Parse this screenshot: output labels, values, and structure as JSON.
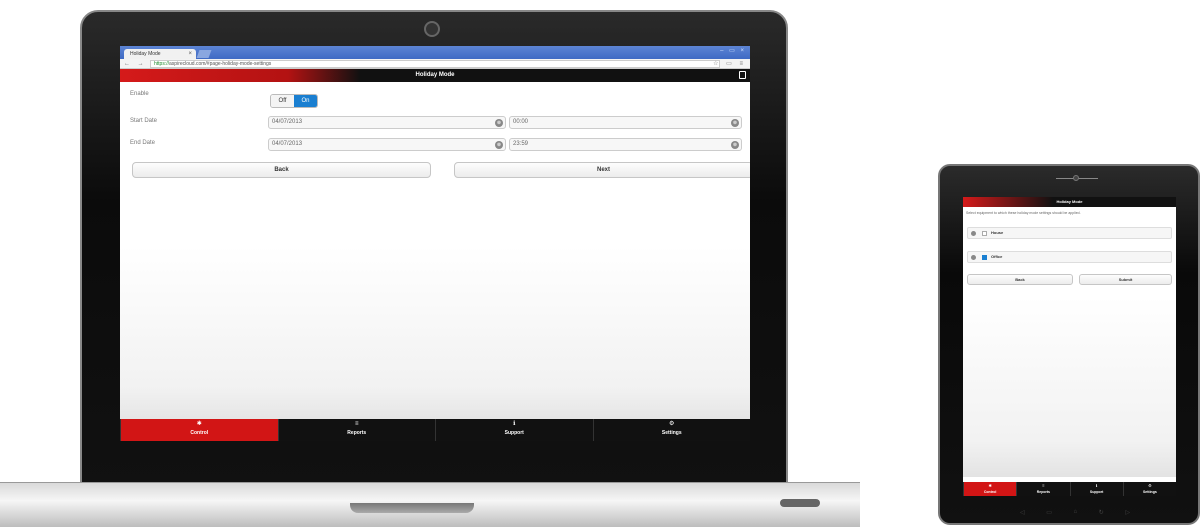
{
  "laptop": {
    "browser": {
      "tab_title": "Holiday Mode",
      "tab_close": "×",
      "window_controls": "– ▭ ×",
      "nav_icons": "← → C",
      "url_scheme": "https://",
      "url_host": "aspirecloud.com",
      "url_path": "/#page-holiday-mode-settings",
      "addr_icons": "☆ ▭ ≡"
    },
    "app": {
      "title": "Holiday Mode",
      "enable_label": "Enable",
      "toggle_off": "Off",
      "toggle_on": "On",
      "start_date_label": "Start Date",
      "start_date_value": "04/07/2013",
      "start_time_value": "00:00",
      "end_date_label": "End Date",
      "end_date_value": "04/07/2013",
      "end_time_value": "23:59",
      "clear_glyph": "⊗",
      "back_label": "Back",
      "next_label": "Next"
    },
    "nav": [
      {
        "icon": "✱",
        "label": "Control",
        "active": true
      },
      {
        "icon": "≡",
        "label": "Reports",
        "active": false
      },
      {
        "icon": "ℹ",
        "label": "Support",
        "active": false
      },
      {
        "icon": "⚙",
        "label": "Settings",
        "active": false
      }
    ]
  },
  "tablet": {
    "title": "Holiday Mode",
    "instruction": "Select equipment to which these holiday mode settings should be applied.",
    "items": [
      {
        "name": "House",
        "checked": false
      },
      {
        "name": "Office",
        "checked": true
      }
    ],
    "back_label": "Back",
    "submit_label": "Submit",
    "nav": [
      {
        "icon": "✱",
        "label": "Control"
      },
      {
        "icon": "≡",
        "label": "Reports"
      },
      {
        "icon": "ℹ",
        "label": "Support"
      },
      {
        "icon": "⚙",
        "label": "Settings"
      }
    ],
    "home_bar": [
      "◁",
      "▭",
      "⌂",
      "↻",
      "▷"
    ]
  },
  "colors": {
    "brand_red": "#d21515",
    "toggle_on_blue": "#1a7fd1",
    "header_dark": "#111111"
  }
}
